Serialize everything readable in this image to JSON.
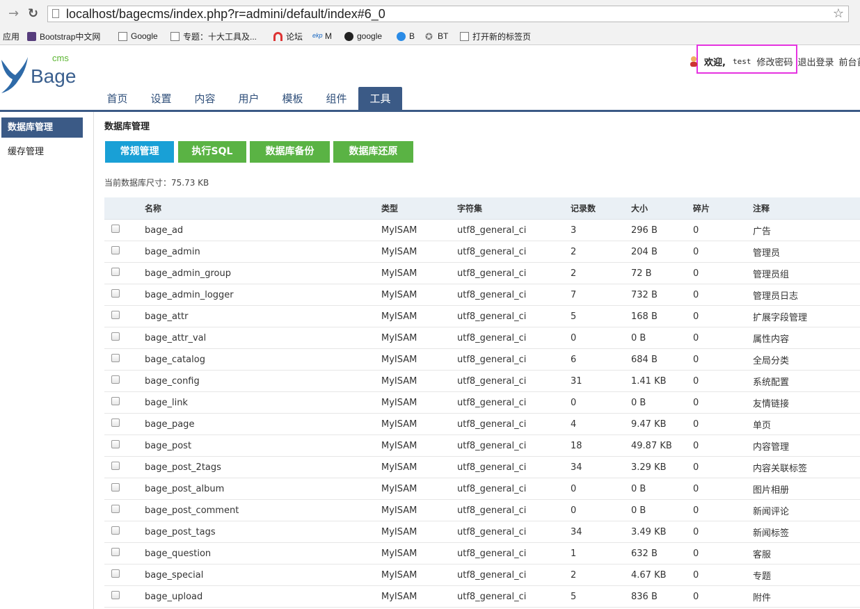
{
  "browser": {
    "url": "localhost/bagecms/index.php?r=admini/default/index#6_0",
    "bookmarks": [
      "应用",
      "Bootstrap中文网",
      "Google",
      "专题：十大工具及...",
      "论坛",
      "M",
      "google",
      "B",
      "BT",
      "打开新的标签页"
    ]
  },
  "logo": {
    "small": "cms",
    "big": "Bage"
  },
  "user": {
    "welcome": "欢迎,",
    "name": "test",
    "change_password": "修改密码",
    "logout": "退出登录",
    "frontpage": "前台首页"
  },
  "nav": {
    "tabs": [
      "首页",
      "设置",
      "内容",
      "用户",
      "模板",
      "组件",
      "工具"
    ],
    "active": "工具"
  },
  "sidebar": {
    "items": [
      "数据库管理",
      "缓存管理"
    ]
  },
  "content": {
    "title": "数据库管理",
    "buttons": [
      "常规管理",
      "执行SQL",
      "数据库备份",
      "数据库还原"
    ],
    "db_size_label": "当前数据库尺寸：75.73 KB"
  },
  "table": {
    "headers": [
      "",
      "名称",
      "类型",
      "字符集",
      "记录数",
      "大小",
      "碎片",
      "注释"
    ],
    "rows": [
      [
        "bage_ad",
        "MyISAM",
        "utf8_general_ci",
        "3",
        "296 B",
        "0",
        "广告"
      ],
      [
        "bage_admin",
        "MyISAM",
        "utf8_general_ci",
        "2",
        "204 B",
        "0",
        "管理员"
      ],
      [
        "bage_admin_group",
        "MyISAM",
        "utf8_general_ci",
        "2",
        "72 B",
        "0",
        "管理员组"
      ],
      [
        "bage_admin_logger",
        "MyISAM",
        "utf8_general_ci",
        "7",
        "732 B",
        "0",
        "管理员日志"
      ],
      [
        "bage_attr",
        "MyISAM",
        "utf8_general_ci",
        "5",
        "168 B",
        "0",
        "扩展字段管理"
      ],
      [
        "bage_attr_val",
        "MyISAM",
        "utf8_general_ci",
        "0",
        "0 B",
        "0",
        "属性内容"
      ],
      [
        "bage_catalog",
        "MyISAM",
        "utf8_general_ci",
        "6",
        "684 B",
        "0",
        "全局分类"
      ],
      [
        "bage_config",
        "MyISAM",
        "utf8_general_ci",
        "31",
        "1.41 KB",
        "0",
        "系统配置"
      ],
      [
        "bage_link",
        "MyISAM",
        "utf8_general_ci",
        "0",
        "0 B",
        "0",
        "友情链接"
      ],
      [
        "bage_page",
        "MyISAM",
        "utf8_general_ci",
        "4",
        "9.47 KB",
        "0",
        "单页"
      ],
      [
        "bage_post",
        "MyISAM",
        "utf8_general_ci",
        "18",
        "49.87 KB",
        "0",
        "内容管理"
      ],
      [
        "bage_post_2tags",
        "MyISAM",
        "utf8_general_ci",
        "34",
        "3.29 KB",
        "0",
        "内容关联标签"
      ],
      [
        "bage_post_album",
        "MyISAM",
        "utf8_general_ci",
        "0",
        "0 B",
        "0",
        "图片相册"
      ],
      [
        "bage_post_comment",
        "MyISAM",
        "utf8_general_ci",
        "0",
        "0 B",
        "0",
        "新闻评论"
      ],
      [
        "bage_post_tags",
        "MyISAM",
        "utf8_general_ci",
        "34",
        "3.49 KB",
        "0",
        "新闻标签"
      ],
      [
        "bage_question",
        "MyISAM",
        "utf8_general_ci",
        "1",
        "632 B",
        "0",
        "客服"
      ],
      [
        "bage_special",
        "MyISAM",
        "utf8_general_ci",
        "2",
        "4.67 KB",
        "0",
        "专题"
      ],
      [
        "bage_upload",
        "MyISAM",
        "utf8_general_ci",
        "5",
        "836 B",
        "0",
        "附件"
      ]
    ]
  },
  "colors": {
    "nav_blue": "#3b5a86",
    "btn_blue": "#19a0d6",
    "btn_green": "#5ab344",
    "highlight": "#e533e0"
  }
}
